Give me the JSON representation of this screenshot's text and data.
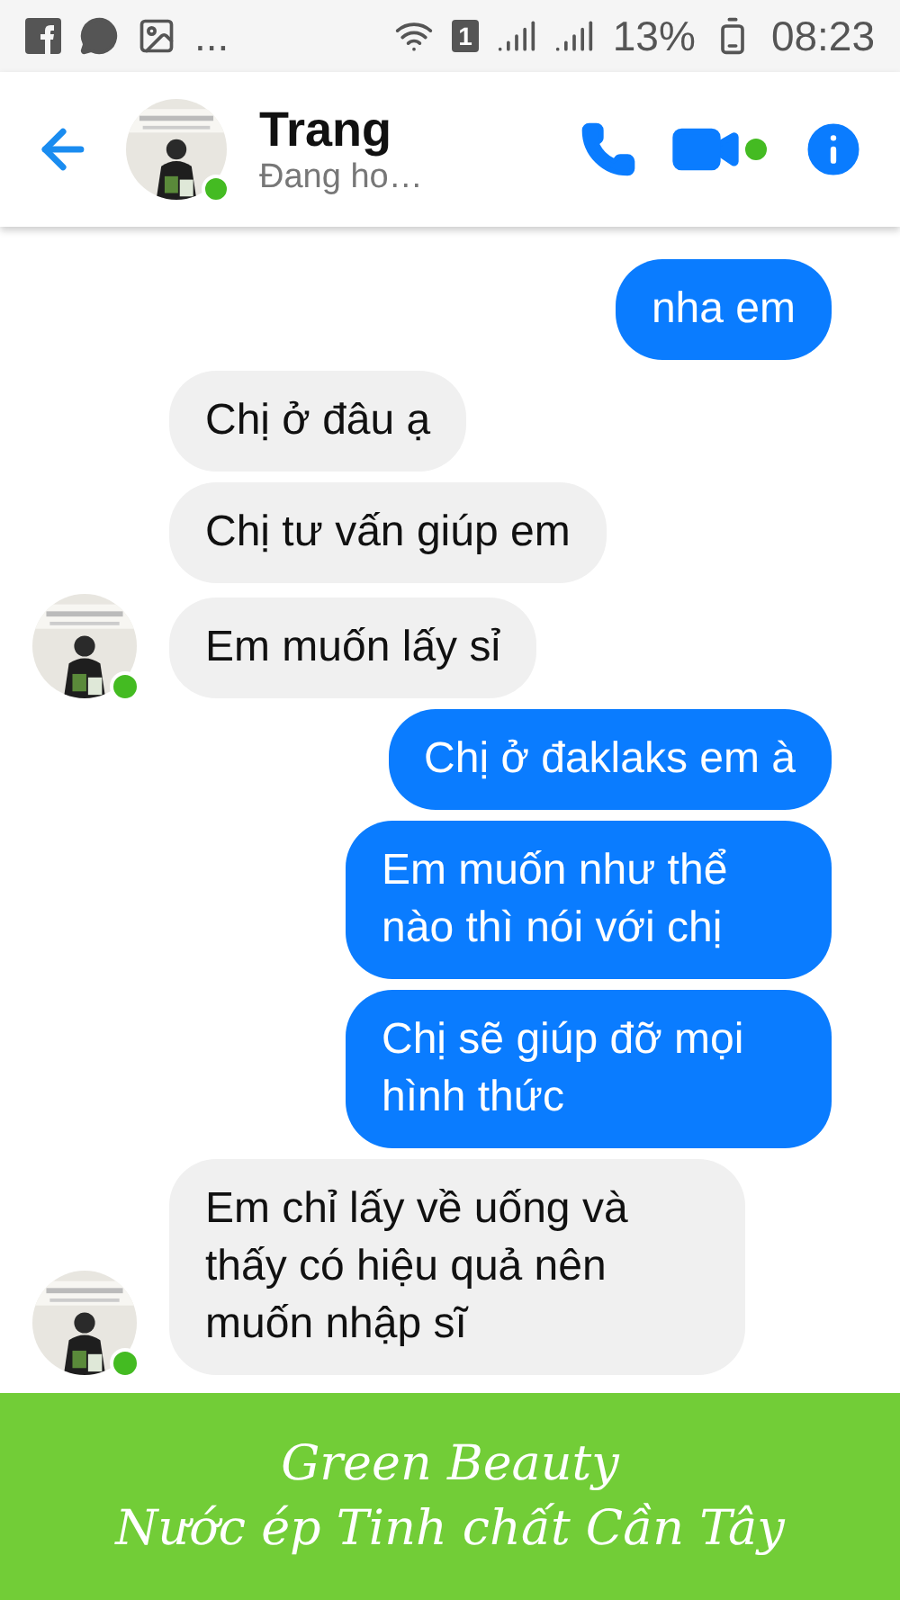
{
  "status_bar": {
    "overflow": "...",
    "sim": "1",
    "battery": "13%",
    "time": "08:23"
  },
  "header": {
    "name": "Trang",
    "status": "Đang ho…",
    "online": true
  },
  "messages": [
    {
      "kind": "outgoing",
      "text": "nha em",
      "avatar": false
    },
    {
      "kind": "incoming",
      "text": "Chị ở đâu ạ",
      "avatar": false
    },
    {
      "kind": "incoming",
      "text": "Chị tư vấn giúp em",
      "avatar": false
    },
    {
      "kind": "incoming",
      "text": "Em muốn lấy sỉ",
      "avatar": true
    },
    {
      "kind": "outgoing",
      "text": "Chị ở đaklaks em à",
      "avatar": false
    },
    {
      "kind": "outgoing",
      "text": "Em muốn như thể nào thì nói với chị",
      "avatar": false
    },
    {
      "kind": "outgoing",
      "text": "Chị sẽ giúp đỡ mọi hình thức",
      "avatar": false
    },
    {
      "kind": "incoming",
      "text": "Em chỉ lấy về uống và thấy có hiệu quả nên muốn nhập sĩ",
      "avatar": true
    }
  ],
  "banner": {
    "title": "Green Beauty",
    "subtitle": "Nước ép Tinh chất Cần Tây"
  }
}
